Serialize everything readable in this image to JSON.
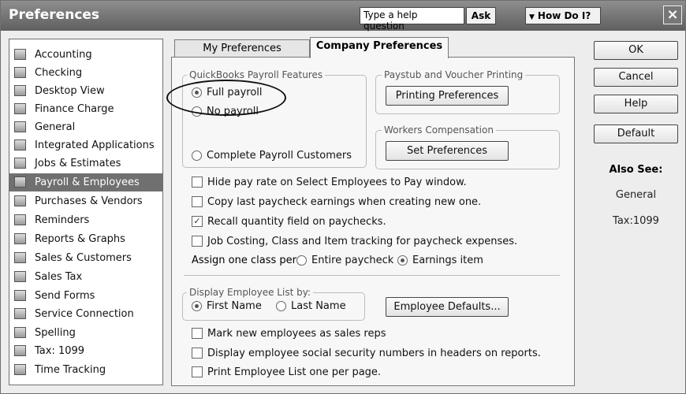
{
  "window": {
    "title": "Preferences"
  },
  "titlebar": {
    "help_placeholder": "Type a help question",
    "ask_label": "Ask",
    "howdoi_label": "How Do I?",
    "close_label": "×"
  },
  "sidebar": {
    "items": [
      {
        "label": "Accounting",
        "icon": "accounting-icon"
      },
      {
        "label": "Checking",
        "icon": "checking-icon"
      },
      {
        "label": "Desktop View",
        "icon": "desktop-view-icon"
      },
      {
        "label": "Finance Charge",
        "icon": "finance-charge-icon"
      },
      {
        "label": "General",
        "icon": "general-icon"
      },
      {
        "label": "Integrated Applications",
        "icon": "integrated-apps-icon"
      },
      {
        "label": "Jobs & Estimates",
        "icon": "jobs-estimates-icon"
      },
      {
        "label": "Payroll & Employees",
        "icon": "payroll-icon",
        "selected": true
      },
      {
        "label": "Purchases & Vendors",
        "icon": "purchases-icon"
      },
      {
        "label": "Reminders",
        "icon": "reminders-icon"
      },
      {
        "label": "Reports & Graphs",
        "icon": "reports-icon"
      },
      {
        "label": "Sales & Customers",
        "icon": "sales-customers-icon"
      },
      {
        "label": "Sales Tax",
        "icon": "sales-tax-icon"
      },
      {
        "label": "Send Forms",
        "icon": "send-forms-icon"
      },
      {
        "label": "Service Connection",
        "icon": "service-connection-icon"
      },
      {
        "label": "Spelling",
        "icon": "spelling-icon"
      },
      {
        "label": "Tax: 1099",
        "icon": "tax-1099-icon"
      },
      {
        "label": "Time Tracking",
        "icon": "time-tracking-icon"
      }
    ]
  },
  "tabs": [
    {
      "label": "My Preferences",
      "active": false
    },
    {
      "label": "Company Preferences",
      "active": true
    }
  ],
  "payroll_features": {
    "title": "QuickBooks Payroll Features",
    "options": [
      {
        "label": "Full payroll",
        "selected": true
      },
      {
        "label": "No payroll",
        "selected": false
      },
      {
        "label": "Complete Payroll Customers",
        "selected": false
      }
    ]
  },
  "paystub": {
    "title": "Paystub and Voucher Printing",
    "button": "Printing Preferences"
  },
  "workers_comp": {
    "title": "Workers Compensation",
    "button": "Set Preferences"
  },
  "checkboxes": [
    {
      "label": "Hide pay rate on Select Employees to Pay window.",
      "checked": false
    },
    {
      "label": "Copy last paycheck earnings when creating new one.",
      "checked": false
    },
    {
      "label": "Recall quantity field on paychecks.",
      "checked": true
    },
    {
      "label": "Job Costing, Class and Item tracking for paycheck expenses.",
      "checked": false
    }
  ],
  "assign_class": {
    "label": "Assign one class per",
    "options": [
      {
        "label": "Entire paycheck",
        "selected": false
      },
      {
        "label": "Earnings item",
        "selected": true
      }
    ]
  },
  "display_employee": {
    "title": "Display Employee List by:",
    "options": [
      {
        "label": "First Name",
        "selected": true
      },
      {
        "label": "Last Name",
        "selected": false
      }
    ]
  },
  "employee_defaults_button": "Employee Defaults...",
  "bottom_checkboxes": [
    {
      "label": "Mark new employees as sales reps",
      "checked": false
    },
    {
      "label": "Display employee social security numbers in headers on reports.",
      "checked": false
    },
    {
      "label": "Print Employee List one per page.",
      "checked": false
    }
  ],
  "right_buttons": {
    "ok": "OK",
    "cancel": "Cancel",
    "help": "Help",
    "default": "Default"
  },
  "also_see": {
    "title": "Also See:",
    "links": [
      "General",
      "Tax:1099"
    ]
  },
  "colors": {
    "titlebar": "#6f6f6f",
    "selected_item": "#707070",
    "panel_bg": "#f7f7f7"
  }
}
